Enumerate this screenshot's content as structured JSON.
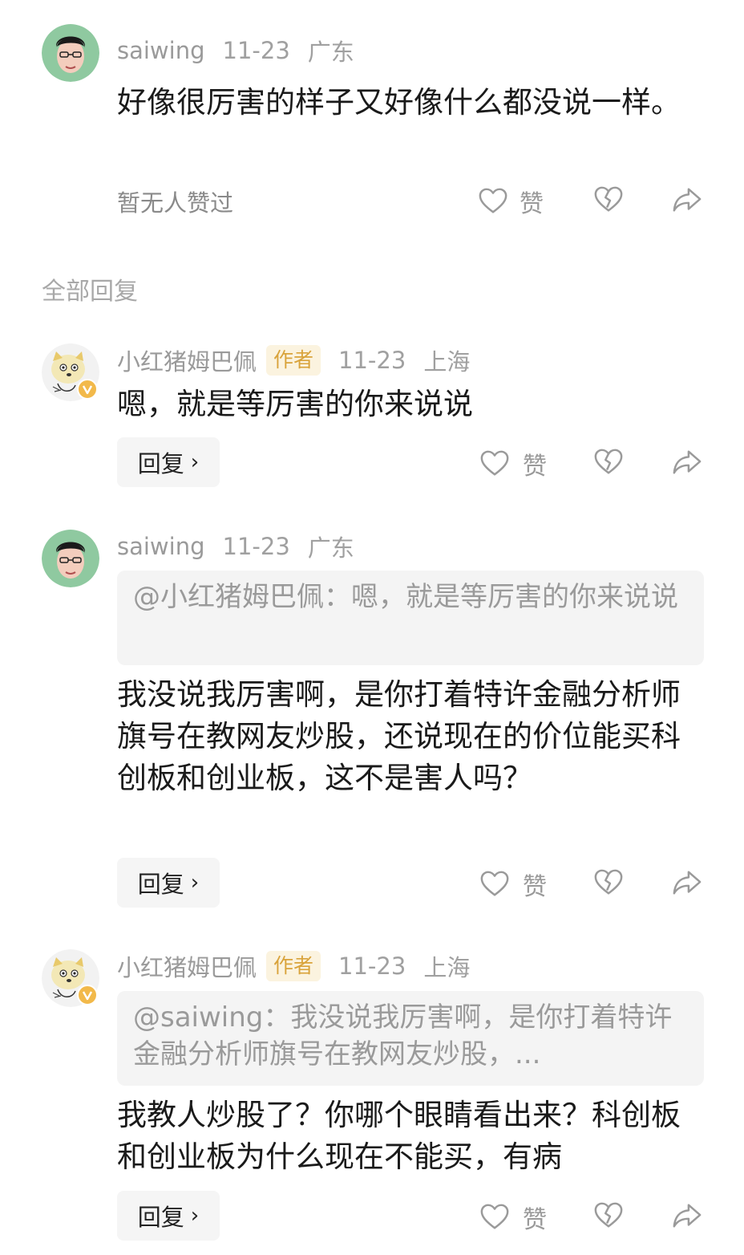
{
  "top_comment": {
    "username": "saiwing",
    "date": "11-23",
    "location": "广东",
    "text": "好像很厉害的样子又好像什么都没说一样。",
    "no_likes": "暂无人赞过",
    "like_label": "赞"
  },
  "section_title": "全部回复",
  "replies": [
    {
      "username": "小红猪姆巴佩",
      "badge": "作者",
      "date": "11-23",
      "location": "上海",
      "text": "嗯，就是等厉害的你来说说",
      "reply_label": "回复",
      "like_label": "赞"
    },
    {
      "username": "saiwing",
      "date": "11-23",
      "location": "广东",
      "quote": "@小红猪姆巴佩：嗯，就是等厉害的你来说说",
      "text": "我没说我厉害啊，是你打着特许金融分析师旗号在教网友炒股，还说现在的价位能买科创板和创业板，这不是害人吗？",
      "reply_label": "回复",
      "like_label": "赞"
    },
    {
      "username": "小红猪姆巴佩",
      "badge": "作者",
      "date": "11-23",
      "location": "上海",
      "quote": "@saiwing：我没说我厉害啊，是你打着特许金融分析师旗号在教网友炒股，...",
      "text": "我教人炒股了？你哪个眼睛看出来？科创板和创业板为什么现在不能买，有病",
      "reply_label": "回复",
      "like_label": "赞"
    }
  ],
  "colors": {
    "meta": "#a0a0a0",
    "badge_bg": "#fbf3df",
    "badge_text": "#d9a33b",
    "quote_bg": "#f4f4f4"
  }
}
